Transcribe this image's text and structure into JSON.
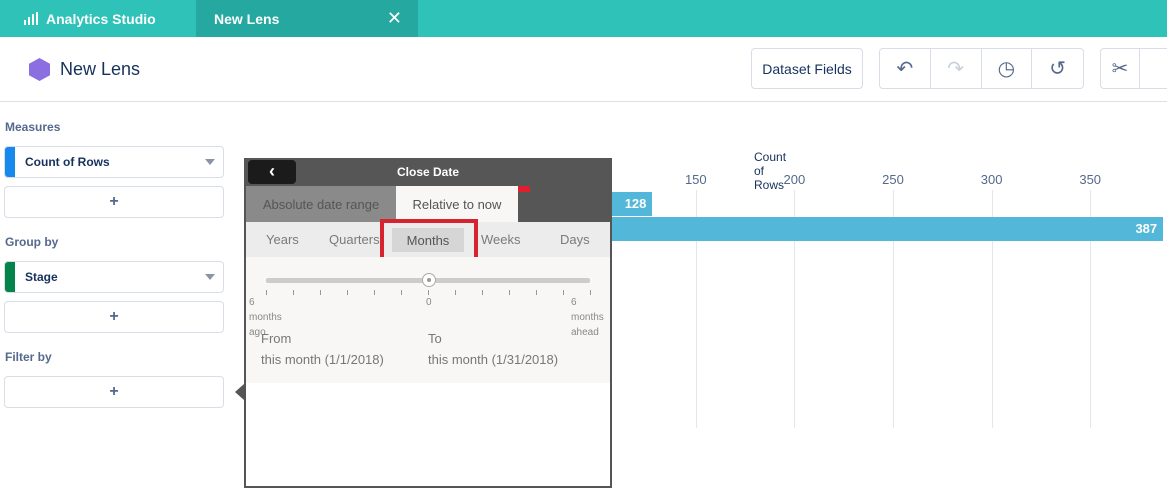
{
  "tabs": {
    "app": "Analytics Studio",
    "lens": "New Lens",
    "close": "✕"
  },
  "header": {
    "title": "New Lens",
    "dataset_fields": "Dataset Fields",
    "undo": "↶",
    "redo": "↷",
    "history": "◷",
    "reset": "↺",
    "cut": "✂"
  },
  "sidebar": {
    "measures_label": "Measures",
    "measure": "Count of Rows",
    "group_label": "Group by",
    "group": "Stage",
    "filter_label": "Filter by",
    "add": "+"
  },
  "chart_data": {
    "type": "bar",
    "orientation": "horizontal",
    "title": "Count of Rows",
    "ticks": [
      150,
      200,
      250,
      300,
      350
    ],
    "values": [
      128,
      387
    ],
    "xlim": [
      0,
      390
    ],
    "accent": "#52b7d8"
  },
  "popover": {
    "title": "Close Date",
    "back": "‹",
    "tabs": [
      "Absolute date range",
      "Relative to now"
    ],
    "active_tab": 1,
    "units": [
      "Years",
      "Quarters",
      "Months",
      "Weeks",
      "Days"
    ],
    "active_unit": "Months",
    "slider_value": 0,
    "slider_min": [
      "6",
      "months",
      "ago"
    ],
    "slider_mid": "0",
    "slider_max": [
      "6",
      "months",
      "ahead"
    ],
    "from_label": "From",
    "from_value": "this month (1/1/2018)",
    "to_label": "To",
    "to_value": "this month (1/31/2018)"
  }
}
